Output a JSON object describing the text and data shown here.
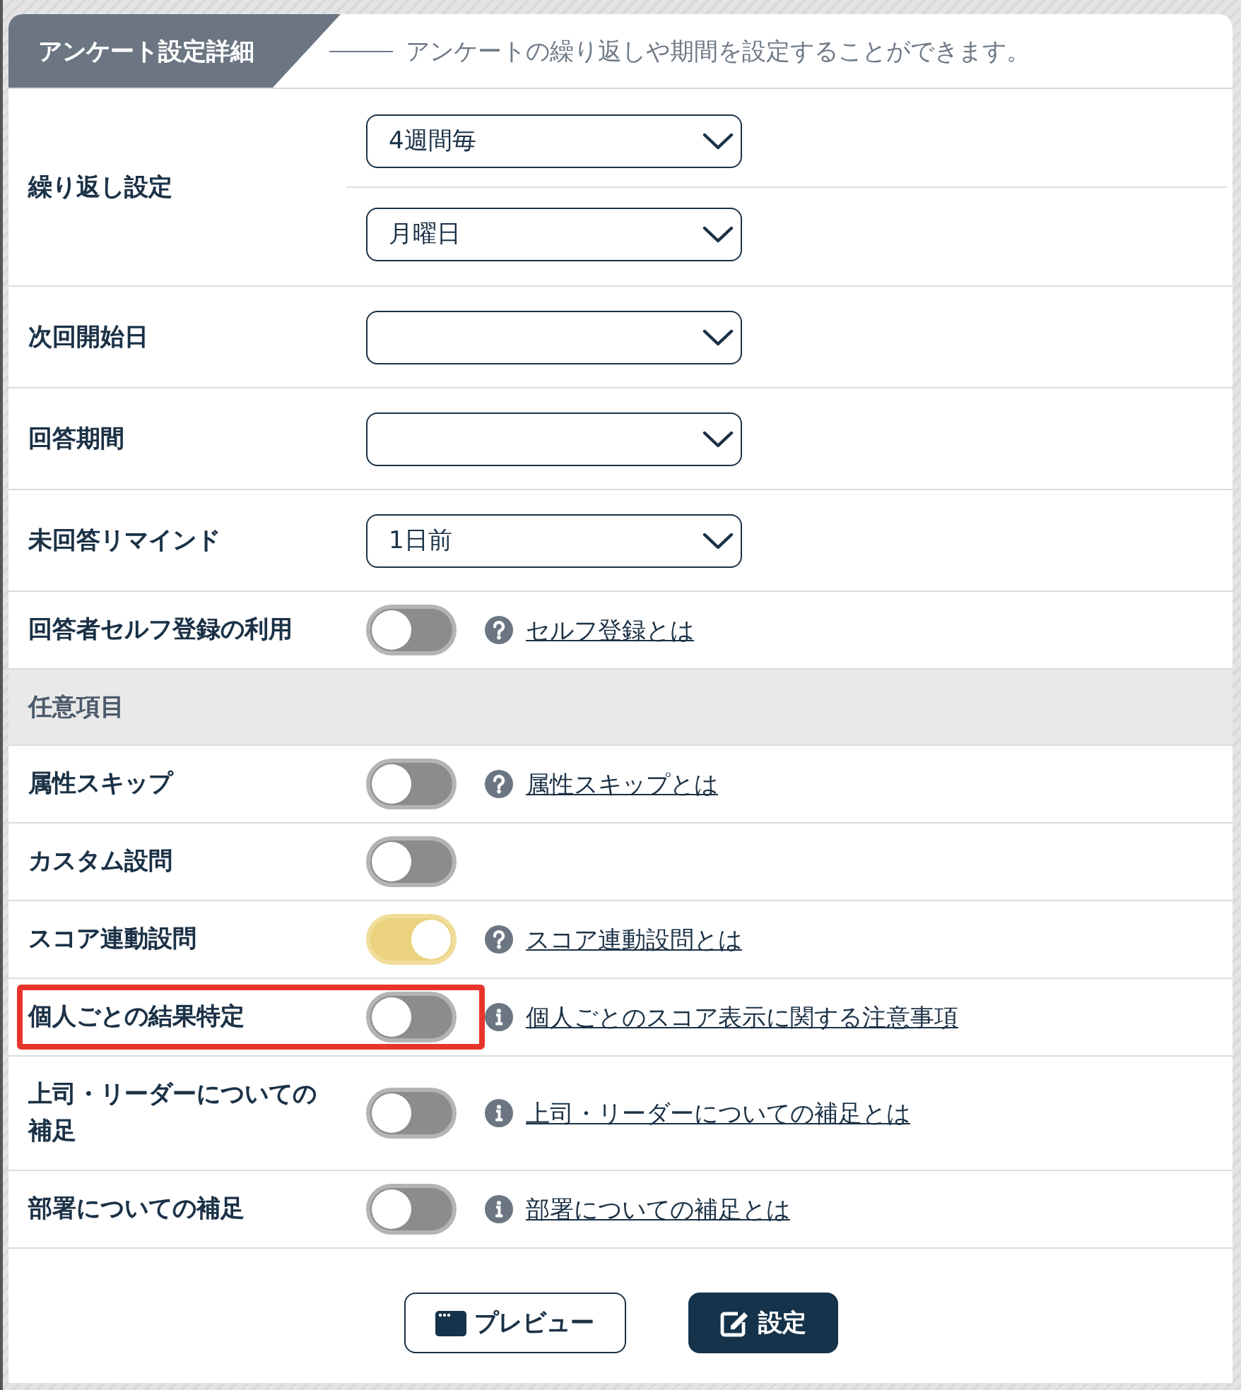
{
  "panel": {
    "title": "アンケート設定詳細",
    "description": "アンケートの繰り返しや期間を設定することができます。"
  },
  "rows": [
    {
      "kind": "select",
      "label": "繰り返し設定",
      "highlighted": false,
      "selects": [
        "4週間毎",
        "月曜日"
      ]
    },
    {
      "kind": "select",
      "label": "次回開始日",
      "highlighted": false
    },
    {
      "kind": "select",
      "label": "回答期間",
      "highlighted": false
    },
    {
      "kind": "select",
      "label": "未回答リマインド",
      "highlighted": false,
      "selects": [
        "1日前"
      ]
    },
    {
      "kind": "toggle",
      "label": "回答者セルフ登録の利用",
      "highlighted": false,
      "on": false,
      "help": {
        "kind": "question",
        "text": "セルフ登録とは"
      }
    },
    {
      "kind": "section",
      "label": "任意項目",
      "highlighted": false
    },
    {
      "kind": "toggle",
      "label": "属性スキップ",
      "highlighted": false,
      "on": false,
      "help": {
        "kind": "question",
        "text": "属性スキップとは"
      }
    },
    {
      "kind": "toggle",
      "label": "カスタム設問",
      "highlighted": false,
      "on": false
    },
    {
      "kind": "toggle",
      "label": "スコア連動設問",
      "highlighted": false,
      "on": true,
      "help": {
        "kind": "question",
        "text": "スコア連動設問とは"
      }
    },
    {
      "kind": "toggle",
      "label": "個人ごとの結果特定",
      "highlighted": true,
      "on": false,
      "help": {
        "kind": "info",
        "text": "個人ごとのスコア表示に関する注意事項"
      }
    },
    {
      "kind": "toggle",
      "label": "上司・リーダーについての補足",
      "highlighted": false,
      "on": false,
      "help": {
        "kind": "info",
        "text": "上司・リーダーについての補足とは"
      }
    },
    {
      "kind": "toggle",
      "label": "部署についての補足",
      "highlighted": false,
      "on": false,
      "help": {
        "kind": "info",
        "text": "部署についての補足とは"
      }
    }
  ],
  "buttons": [
    {
      "kind": "preview",
      "label": "プレビュー"
    },
    {
      "kind": "submit",
      "label": "設定"
    }
  ]
}
